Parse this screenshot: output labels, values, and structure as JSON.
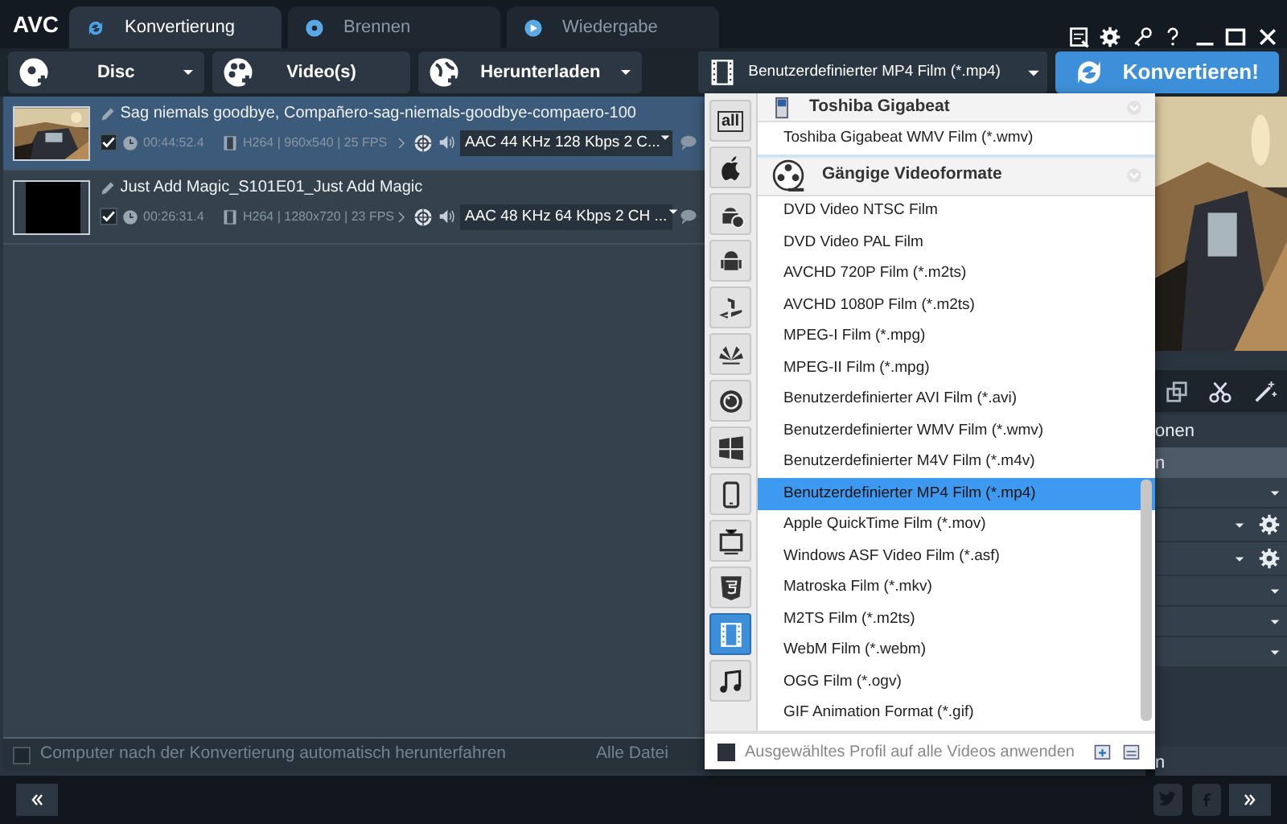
{
  "app": {
    "logo": "AVC"
  },
  "tabs": [
    {
      "label": "Konvertierung",
      "kind": "convert",
      "selected": true
    },
    {
      "label": "Brennen",
      "kind": "burn",
      "selected": false
    },
    {
      "label": "Wiedergabe",
      "kind": "play",
      "selected": false
    }
  ],
  "toolbar": {
    "buttons": [
      {
        "label": "Disc",
        "kind": "disc",
        "dropdown": true
      },
      {
        "label": "Video(s)",
        "kind": "video",
        "dropdown": false
      },
      {
        "label": "Herunterladen",
        "kind": "download",
        "dropdown": true
      }
    ],
    "profile": "Benutzerdefinierter MP4 Film (*.mp4)",
    "convert": "Konvertieren!"
  },
  "files": [
    {
      "title": "Sag niemals goodbye, Compañero-sag-niemals-goodbye-compaero-100",
      "selected": true,
      "checked": true,
      "duration": "00:44:52.4",
      "video_info": "H264 | 960x540 | 25 FPS",
      "audio": "AAC 44 KHz 128 Kbps 2 C..."
    },
    {
      "title": "Just Add Magic_S101E01_Just Add Magic",
      "selected": false,
      "checked": true,
      "duration": "00:26:31.4",
      "video_info": "H264 | 1280x720 | 23 FPS",
      "audio": "AAC 48 KHz 64 Kbps 2 CH ..."
    }
  ],
  "footer": {
    "shutdown": {
      "label": "Computer nach der Konvertierung automatisch herunterfahren",
      "checked": false
    },
    "files_label": "Alle Datei"
  },
  "profile_menu": {
    "categories": [
      {
        "kind": "all",
        "label": "all",
        "selected": false
      },
      {
        "kind": "apple",
        "selected": false
      },
      {
        "kind": "android-s",
        "selected": false
      },
      {
        "kind": "android",
        "selected": false
      },
      {
        "kind": "playstation",
        "selected": false
      },
      {
        "kind": "huawei",
        "selected": false
      },
      {
        "kind": "lg",
        "selected": false
      },
      {
        "kind": "windows",
        "selected": false
      },
      {
        "kind": "phone",
        "selected": false
      },
      {
        "kind": "tv",
        "selected": false
      },
      {
        "kind": "html5",
        "selected": false
      },
      {
        "kind": "film",
        "selected": true
      },
      {
        "kind": "music",
        "selected": false
      }
    ],
    "entries": [
      {
        "kind": "group",
        "label": "Toshiba Gigabeat"
      },
      {
        "kind": "item",
        "label": "Toshiba Gigabeat WMV Film (*.wmv)",
        "selected": false
      },
      {
        "kind": "group",
        "label": "Gängige Videoformate"
      },
      {
        "kind": "item",
        "label": "DVD Video NTSC Film",
        "selected": false
      },
      {
        "kind": "item",
        "label": "DVD Video PAL Film",
        "selected": false
      },
      {
        "kind": "item",
        "label": "AVCHD 720P Film (*.m2ts)",
        "selected": false
      },
      {
        "kind": "item",
        "label": "AVCHD 1080P Film (*.m2ts)",
        "selected": false
      },
      {
        "kind": "item",
        "label": "MPEG-I Film (*.mpg)",
        "selected": false
      },
      {
        "kind": "item",
        "label": "MPEG-II Film (*.mpg)",
        "selected": false
      },
      {
        "kind": "item",
        "label": "Benutzerdefinierter AVI Film (*.avi)",
        "selected": false
      },
      {
        "kind": "item",
        "label": "Benutzerdefinierter WMV Film (*.wmv)",
        "selected": false
      },
      {
        "kind": "item",
        "label": "Benutzerdefinierter M4V Film (*.m4v)",
        "selected": false
      },
      {
        "kind": "item",
        "label": "Benutzerdefinierter MP4 Film (*.mp4)",
        "selected": true
      },
      {
        "kind": "item",
        "label": "Apple QuickTime Film (*.mov)",
        "selected": false
      },
      {
        "kind": "item",
        "label": "Windows ASF Video Film (*.asf)",
        "selected": false
      },
      {
        "kind": "item",
        "label": "Matroska Film (*.mkv)",
        "selected": false
      },
      {
        "kind": "item",
        "label": "M2TS Film (*.m2ts)",
        "selected": false
      },
      {
        "kind": "item",
        "label": "WebM Film (*.webm)",
        "selected": false
      },
      {
        "kind": "item",
        "label": "OGG Film (*.ogv)",
        "selected": false
      },
      {
        "kind": "item",
        "label": "GIF Animation Format (*.gif)",
        "selected": false
      }
    ],
    "apply_all": {
      "label": "Ausgewähltes Profil auf alle Videos anwenden",
      "checked": false
    }
  },
  "side_panel": {
    "heading": "onen",
    "active_row": "n",
    "fields": [
      {
        "gear": false
      },
      {
        "gear": true
      },
      {
        "gear": true
      },
      {
        "gear": false
      },
      {
        "gear": false
      },
      {
        "gear": false
      }
    ],
    "bottom_label": "n"
  }
}
